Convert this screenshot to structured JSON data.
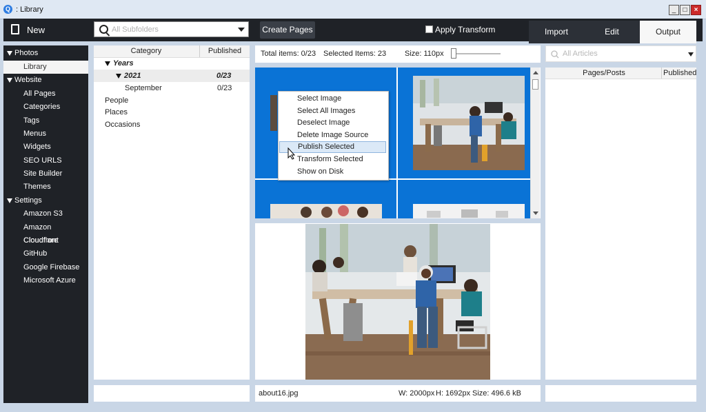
{
  "window": {
    "title": ": Library",
    "icon": "app-logo-icon",
    "controls": [
      "minimize-icon",
      "maximize-icon",
      "close-icon"
    ]
  },
  "toolbar": {
    "new_label": "New",
    "search_placeholder": "All Subfolders",
    "create_pages_label": "Create Pages",
    "apply_transform_label": "Apply Transform",
    "apply_transform_checked": false
  },
  "tabs": [
    {
      "label": "Import",
      "active": false
    },
    {
      "label": "Edit",
      "active": false
    },
    {
      "label": "Output",
      "active": true
    }
  ],
  "sidebar": {
    "photos": "Photos",
    "library": "Library",
    "website": "Website",
    "website_items": [
      "All Pages",
      "Categories",
      "Tags",
      "Menus",
      "Widgets",
      "SEO URLS",
      "Site Builder",
      "Themes"
    ],
    "settings": "Settings",
    "settings_items": [
      "Amazon S3",
      "Amazon Cloudfront",
      "Cloudflare",
      "GitHub",
      "Google Firebase",
      "Microsoft Azure"
    ]
  },
  "categories": {
    "col_category": "Category",
    "col_published": "Published",
    "years": "Years",
    "year_2021": "2021",
    "year_2021_count": "0/23",
    "month": "September",
    "month_count": "0/23",
    "others": [
      "People",
      "Places",
      "Occasions"
    ]
  },
  "images": {
    "total_items": "Total items: 0/23",
    "selected_items": "Selected Items: 23",
    "size": "Size: 110px",
    "size_slider": 0
  },
  "context_menu": {
    "items": [
      "Select Image",
      "Select All Images",
      "Deselect Image",
      "Delete Image Source",
      "Publish Selected",
      "Transform Selected",
      "Show on Disk"
    ],
    "highlighted": "Publish Selected"
  },
  "preview": {
    "filename": "about16.jpg",
    "width": "W: 2000px",
    "height": "H: 1692px",
    "filesize": "Size: 496.6 kB"
  },
  "articles": {
    "placeholder": "All Articles",
    "col_pages": "Pages/Posts",
    "col_published": "Published"
  },
  "colors": {
    "accent": "#0a73d6",
    "dark": "#1f2227",
    "highlight": "#dbe9f7"
  }
}
